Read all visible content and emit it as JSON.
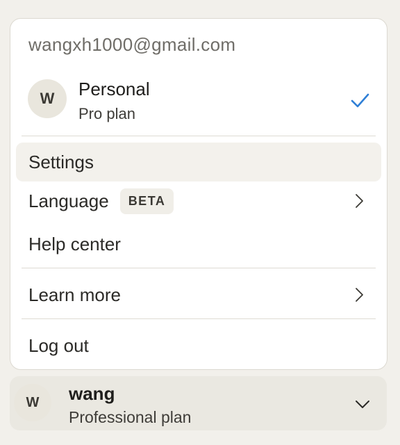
{
  "menu": {
    "email": "wangxh1000@gmail.com",
    "account": {
      "initial": "W",
      "name": "Personal",
      "plan": "Pro plan",
      "selected_icon": "check-icon"
    },
    "items": [
      {
        "label": "Settings",
        "active": true
      },
      {
        "label": "Language",
        "badge": "BETA",
        "icon": "chevron-right-icon"
      },
      {
        "label": "Help center"
      },
      {
        "label": "Learn more",
        "icon": "chevron-right-icon"
      },
      {
        "label": "Log out"
      }
    ]
  },
  "footer": {
    "initial": "W",
    "name": "wang",
    "plan": "Professional plan",
    "icon": "chevron-down-icon"
  },
  "colors": {
    "accent_check": "#2f7fd6",
    "background": "#f2f0eb",
    "menu_bg": "#ffffff",
    "hover_bg": "#f3f1ec"
  }
}
